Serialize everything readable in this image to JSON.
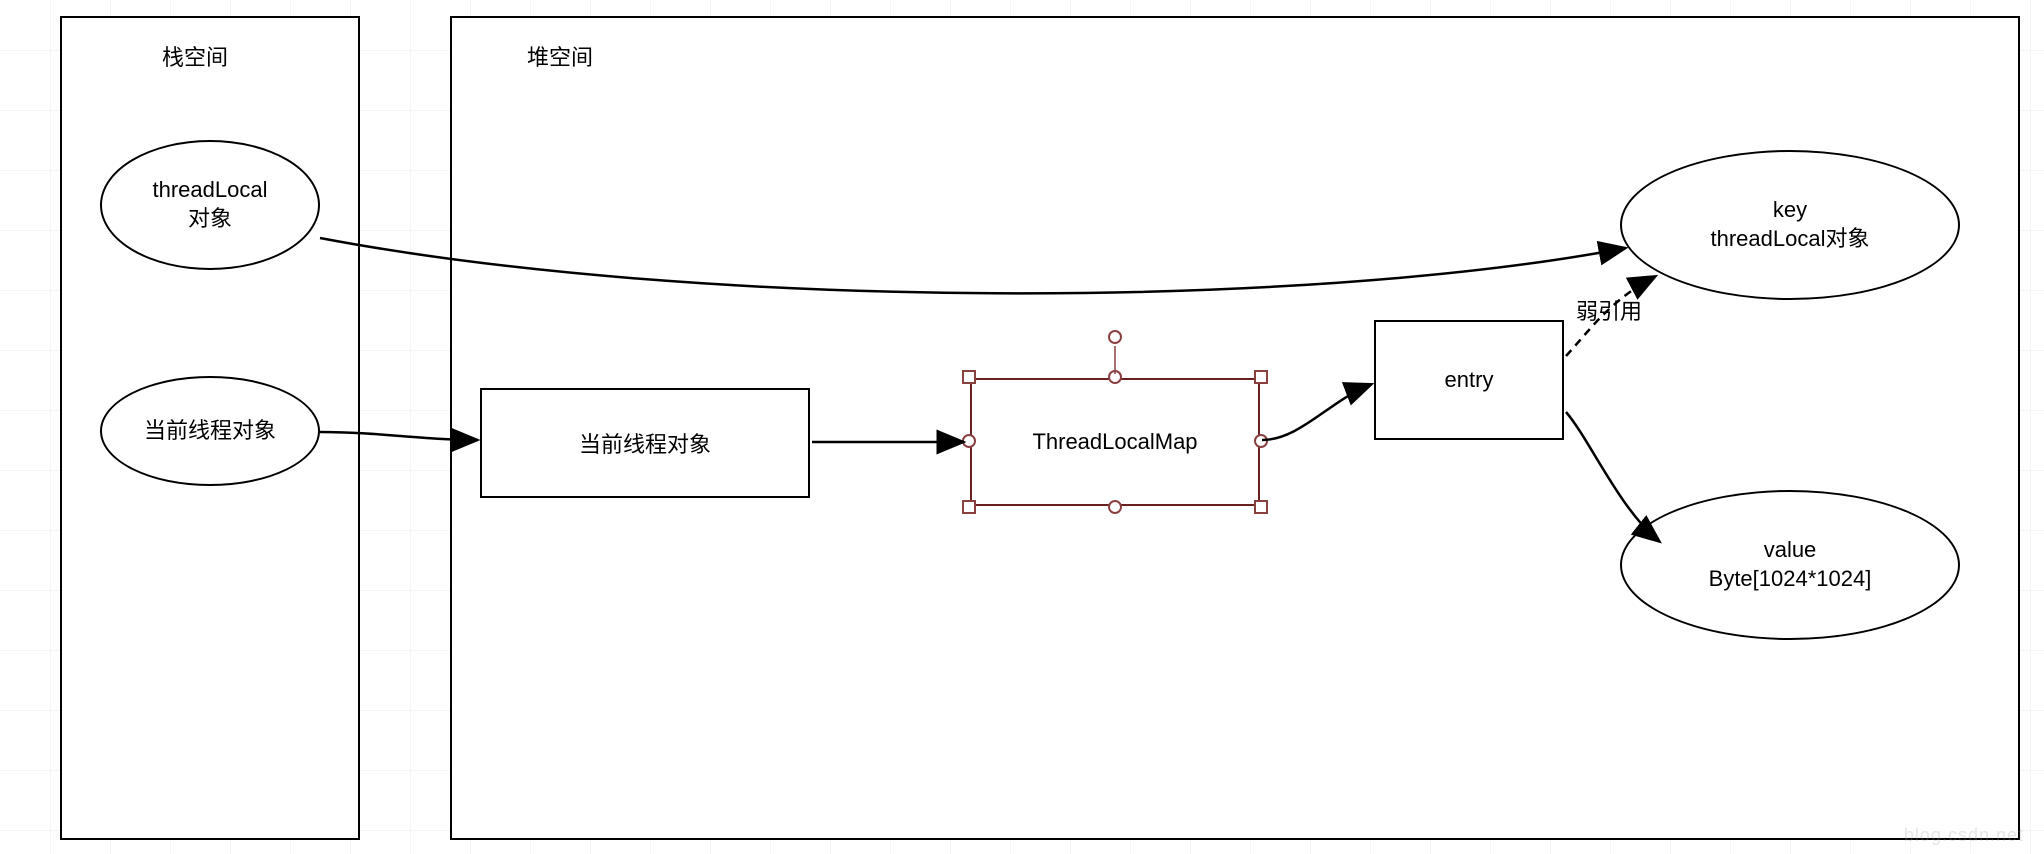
{
  "stack": {
    "title": "栈空间",
    "threadLocalObj": {
      "line1": "threadLocal",
      "line2": "对象"
    },
    "currentThread": "当前线程对象"
  },
  "heap": {
    "title": "堆空间",
    "currentThreadObj": "当前线程对象",
    "threadLocalMap": "ThreadLocalMap",
    "entry": "entry",
    "key": {
      "line1": "key",
      "line2": "threadLocal对象"
    },
    "value": {
      "line1": "value",
      "line2": "Byte[1024*1024]"
    }
  },
  "edges": {
    "weakRef": "弱引用"
  }
}
